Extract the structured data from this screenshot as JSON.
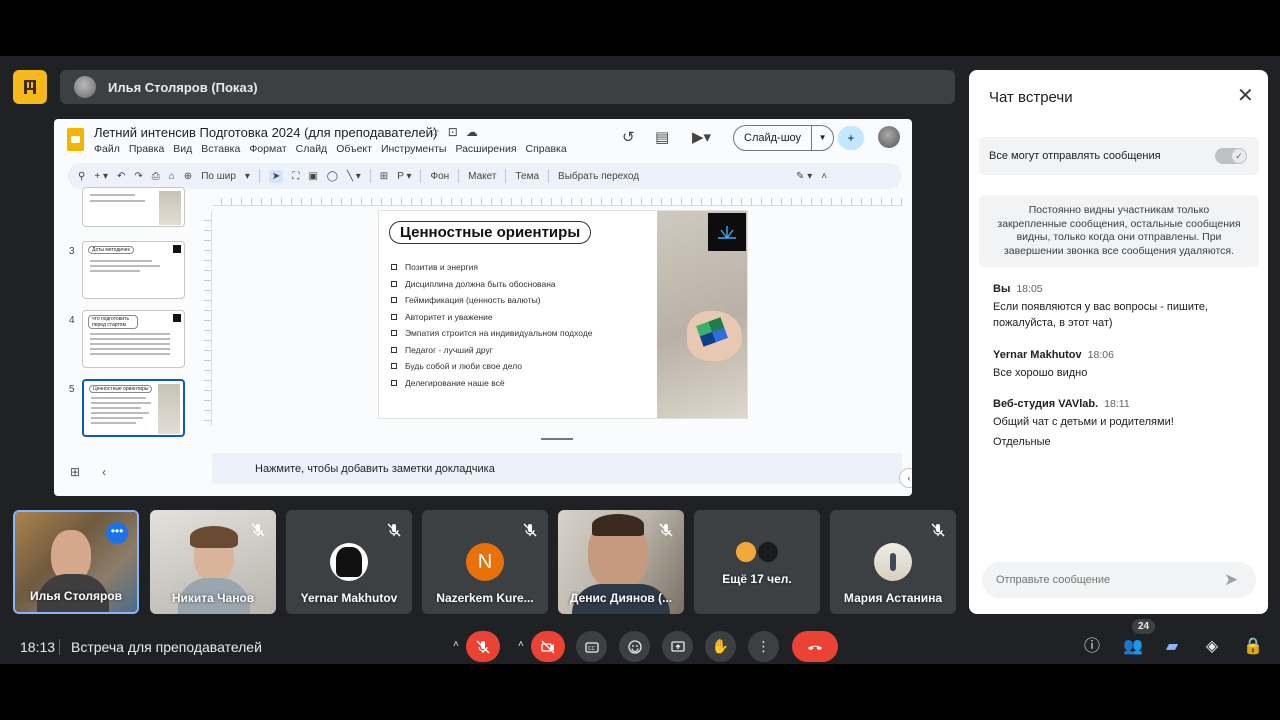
{
  "presenter": {
    "name": "Илья Столяров (Показ)"
  },
  "slides_app": {
    "doc_title": "Летний интенсив Подготовка 2024 (для преподавателей)",
    "menu": [
      "Файл",
      "Правка",
      "Вид",
      "Вставка",
      "Формат",
      "Слайд",
      "Объект",
      "Инструменты",
      "Расширения",
      "Справка"
    ],
    "slideshow_label": "Слайд-шоу",
    "toolbar": {
      "zoom": "По шир",
      "background": "Фон",
      "layout": "Макет",
      "theme": "Тема",
      "transition": "Выбрать переход"
    },
    "thumbnails": [
      {
        "num": "3",
        "title": "Доты методичек"
      },
      {
        "num": "4",
        "title": "что подготовить перед стартом"
      },
      {
        "num": "5",
        "title": "Ценностные ориентиры"
      }
    ],
    "notes_placeholder": "Нажмите, чтобы добавить заметки докладчика",
    "slide": {
      "title": "Ценностные ориентиры",
      "items": [
        "Позитив и энергия",
        "Дисциплина должна быть обоснована",
        "Геймификация (ценность валюты)",
        "Авторитет и уважение",
        "Эмпатия строится на индивидуальном подходе",
        "Педагог - лучший друг",
        "Будь собой и люби свое дело",
        "Делегирование наше всё"
      ]
    }
  },
  "participants": [
    {
      "name": "Илья Столяров"
    },
    {
      "name": "Никита Чанов"
    },
    {
      "name": "Yernar Makhutov"
    },
    {
      "name": "Nazerkem Kure...",
      "initial": "N"
    },
    {
      "name": "Денис Диянов (..."
    },
    {
      "name": "Ещё 17 чел."
    },
    {
      "name": "Мария Астанина"
    }
  ],
  "chat": {
    "title": "Чат встречи",
    "permission": "Все могут отправлять сообщения",
    "info": "Постоянно видны участникам только закрепленные сообщения, остальные сообщения видны, только когда они отправлены. При завершении звонка все сообщения удаляются.",
    "messages": [
      {
        "sender": "Вы",
        "time": "18:05",
        "lines": [
          "Если появляются у вас вопросы - пишите, пожалуйста, в этот чат)"
        ]
      },
      {
        "sender": "Yernar Makhutov",
        "time": "18:06",
        "lines": [
          "Все хорошо видно"
        ]
      },
      {
        "sender": "Веб-студия VAVlab.",
        "time": "18:11",
        "lines": [
          "Общий чат с детьми и родителями!",
          "Отдельные"
        ]
      }
    ],
    "input_placeholder": "Отправьте сообщение"
  },
  "bottom_bar": {
    "time": "18:13",
    "meeting_name": "Встреча для преподавателей",
    "participants_count": "24"
  },
  "colors": {
    "accent": "#8ab4f8",
    "danger": "#ea4335",
    "logo": "#f6b81a",
    "slides_icon": "#f4b400"
  }
}
